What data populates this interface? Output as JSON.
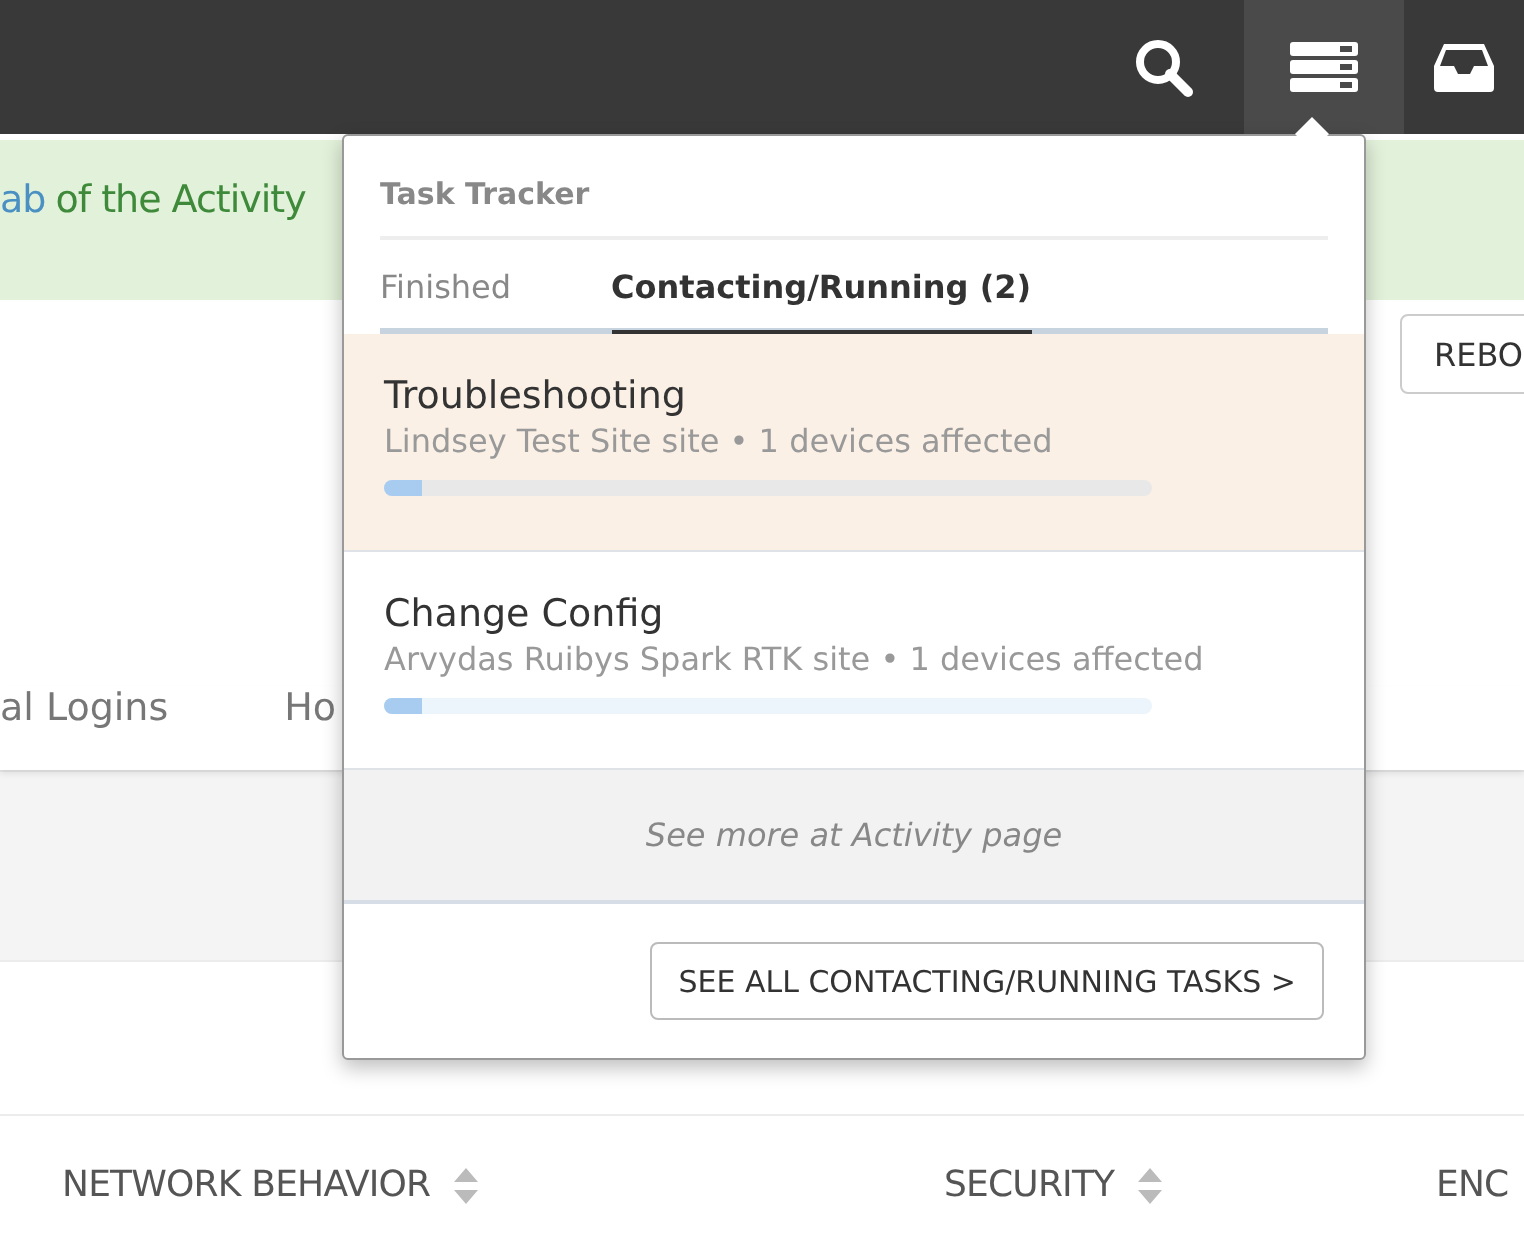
{
  "banner": {
    "link": "ab",
    "text": "of the Activity"
  },
  "reboot_button": "REBO",
  "page_tabs": [
    "al Logins",
    "Ho"
  ],
  "table": {
    "columns": [
      {
        "label": "NETWORK BEHAVIOR",
        "sortable": true
      },
      {
        "label": "SECURITY",
        "sortable": true
      },
      {
        "label": "ENC"
      }
    ]
  },
  "task_tracker": {
    "title": "Task Tracker",
    "tabs": [
      {
        "label": "Finished",
        "selected": false
      },
      {
        "label": "Contacting/Running (2)",
        "selected": true
      }
    ],
    "tasks": [
      {
        "name": "Troubleshooting",
        "detail": "Lindsey Test Site site • 1 devices affected",
        "level": 0.05,
        "highlighted": true
      },
      {
        "name": "Change Config",
        "detail": "Arvydas Ruibys Spark RTK site • 1 devices affected",
        "level": 0.05,
        "highlighted": false
      }
    ],
    "more_link": "See more at Activity page",
    "button": "SEE ALL CONTACTING/RUNNING TASKS >"
  }
}
